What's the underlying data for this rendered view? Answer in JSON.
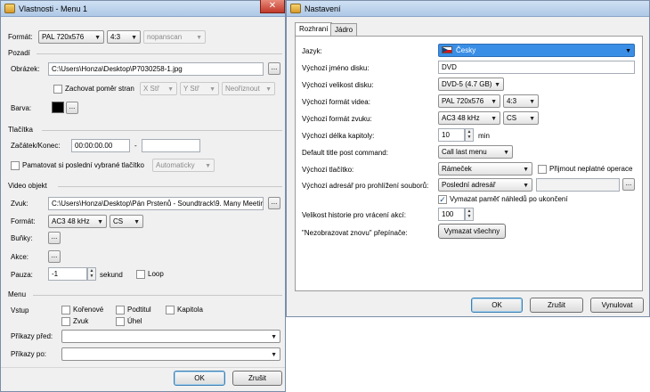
{
  "left": {
    "title": "Vlastnosti - Menu 1",
    "format_label": "Formát:",
    "format_value": "PAL 720x576",
    "aspect_value": "4:3",
    "pan_value": "nopanscan",
    "pozadi": "Pozadí",
    "obrazek_label": "Obrázek:",
    "obrazek_path": "C:\\Users\\Honza\\Desktop\\P7030258-1.jpg",
    "browse": "...",
    "zachovat": "Zachovat poměr stran",
    "x_str": "X Stř",
    "y_str": "Y Stř",
    "neorez": "Neořiznout",
    "barva_label": "Barva:",
    "tlacitka": "Tlačítka",
    "zacatek_label": "Začátek/Konec:",
    "zacatek_value": "00:00:00.00",
    "dash": "-",
    "pamatovat": "Pamatovat si poslední vybrané tlačítko",
    "automaticky": "Automaticky",
    "video_objekt": "Video objekt",
    "zvuk_label": "Zvuk:",
    "zvuk_path": "C:\\Users\\Honza\\Desktop\\Pán Prstenů - Soundtrack\\9. Many Meetir",
    "format2_label": "Formát:",
    "audio_value": "AC3 48 kHz",
    "lang_value": "CS",
    "bunky_label": "Buňky:",
    "akce_label": "Akce:",
    "pauza_label": "Pauza:",
    "pauza_value": "-1",
    "sekund": "sekund",
    "loop": "Loop",
    "menu": "Menu",
    "vstup_label": "Vstup",
    "korenove": "Kořenové",
    "podtitul": "Podtitul",
    "kapitola": "Kapitola",
    "zvuk_cb": "Zvuk",
    "uhel": "Úhel",
    "prikazy_pred": "Příkazy před:",
    "prikazy_po": "Příkazy po:",
    "ok": "OK",
    "zrusit": "Zrušit"
  },
  "right": {
    "title": "Nastavení",
    "tab1": "Rozhraní",
    "tab2": "Jádro",
    "jazyk_label": "Jazyk:",
    "jazyk_value": "Česky",
    "jmeno_label": "Výchozí jméno disku:",
    "jmeno_value": "DVD",
    "velikost_label": "Výchozí velikost disku:",
    "velikost_value": "DVD-5 (4.7 GB)",
    "format_video_label": "Výchozí formát videa:",
    "video_value": "PAL 720x576",
    "video_aspect": "4:3",
    "format_zvuku_label": "Výchozí formát zvuku:",
    "audio_value": "AC3 48 kHz",
    "audio_lang": "CS",
    "delka_label": "Výchozí délka kapitoly:",
    "delka_value": "10",
    "min": "min",
    "default_title_label": "Default title post command:",
    "default_title_value": "Call last menu",
    "tlacitko_label": "Výchozí tlačítko:",
    "tlacitko_value": "Rámeček",
    "prijmout": "Přijmout neplatné operace",
    "adresar_label": "Výchozí adresář pro prohlížení souborů:",
    "adresar_value": "Poslední adresář",
    "browse": "...",
    "vymazat_pamet": "Vymazat paměť náhledů po ukončení",
    "historie_label": "Velikost historie pro vrácení akcí:",
    "historie_value": "100",
    "nezobrazovat_label": "\"Nezobrazovat znovu\" přepínače:",
    "vymazat_vse": "Vymazat všechny",
    "ok": "OK",
    "zrusit": "Zrušit",
    "vynulovat": "Vynulovat"
  },
  "colors": {
    "title_bar": "#bcd3ed",
    "close": "#c8452f",
    "window_bg": "#f0f0f0",
    "check": "#1a4f8a"
  }
}
